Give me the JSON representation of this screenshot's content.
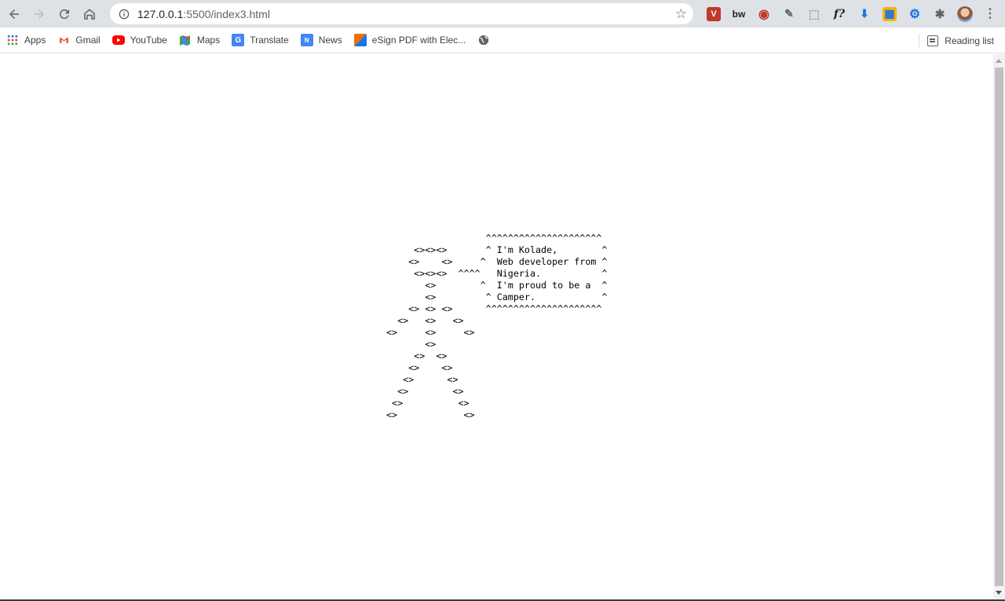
{
  "browser": {
    "url_host": "127.0.0.1",
    "url_path": ":5500/index3.html",
    "icons": {
      "back": "arrow-left-icon",
      "forward": "arrow-right-icon",
      "reload": "reload-icon",
      "home": "home-icon",
      "info": "info-icon",
      "bookmark_star": "star-icon",
      "menu": "three-dot-menu-icon"
    },
    "extensions": [
      {
        "name": "ext-v",
        "label": "V",
        "color": "#c0392b"
      },
      {
        "name": "ext-bw",
        "label": "bw",
        "color": "#ffffff"
      },
      {
        "name": "ext-eye",
        "label": "◉",
        "color": "#ffffff"
      },
      {
        "name": "ext-eyedropper",
        "label": "✎",
        "color": "#ffffff"
      },
      {
        "name": "ext-dotted",
        "label": "⬚",
        "color": "#ffffff"
      },
      {
        "name": "ext-formula",
        "label": "f?",
        "color": "#ffffff"
      },
      {
        "name": "ext-download",
        "label": "⬇",
        "color": "#ffffff"
      },
      {
        "name": "ext-grid",
        "label": "▦",
        "color": "#ffffff"
      },
      {
        "name": "ext-gear-badge",
        "label": "⚙",
        "color": "#ffffff"
      },
      {
        "name": "ext-puzzle",
        "label": "✱",
        "color": "#ffffff"
      }
    ]
  },
  "bookmarks": [
    {
      "label": "Apps",
      "icon": "apps-grid-icon",
      "color": "#4285f4"
    },
    {
      "label": "Gmail",
      "icon": "gmail-icon",
      "color": "#ea4335"
    },
    {
      "label": "YouTube",
      "icon": "youtube-icon",
      "color": "#ff0000"
    },
    {
      "label": "Maps",
      "icon": "maps-icon",
      "color": "#34a853"
    },
    {
      "label": "Translate",
      "icon": "translate-icon",
      "color": "#4285f4"
    },
    {
      "label": "News",
      "icon": "news-icon",
      "color": "#4285f4"
    },
    {
      "label": "eSign PDF with Elec...",
      "icon": "esign-icon",
      "color": "#e8710a"
    },
    {
      "label": "",
      "icon": "globe-icon",
      "color": "#5f6368"
    }
  ],
  "reading_list": "Reading list",
  "page": {
    "ascii_art": "                  ^^^^^^^^^^^^^^^^^^^^^\n     <><><>       ^ I'm Kolade,        ^\n    <>    <>     ^  Web developer from ^\n     <><><>  ^^^^   Nigeria.           ^\n       <>        ^  I'm proud to be a  ^\n       <>         ^ Camper.            ^\n    <> <> <>      ^^^^^^^^^^^^^^^^^^^^^\n  <>   <>   <>\n<>     <>     <>\n       <>\n     <>  <>\n    <>    <>\n   <>      <>\n  <>        <>\n <>          <>\n<>            <>"
  }
}
